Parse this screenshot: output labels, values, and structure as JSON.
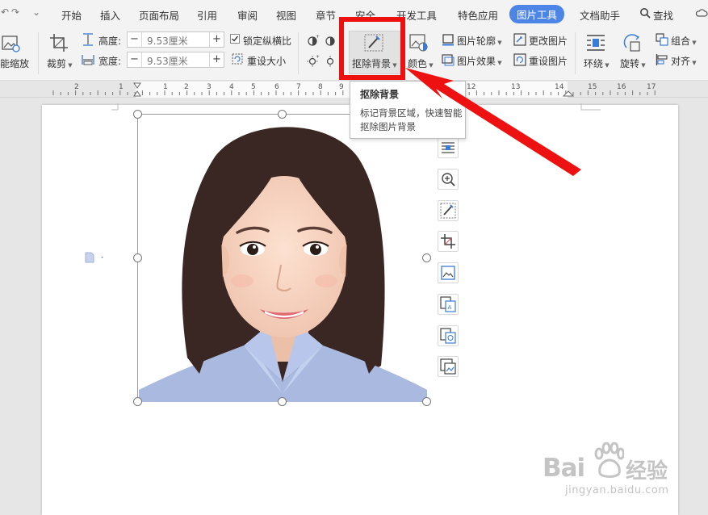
{
  "quick_access": {
    "undo": "↶",
    "redo": "↷",
    "more": "⌄"
  },
  "menu": {
    "items": [
      "开始",
      "插入",
      "页面布局",
      "引用",
      "审阅",
      "视图",
      "章节",
      "安全",
      "开发工具",
      "特色应用",
      "图片工具",
      "文档助手"
    ],
    "active": "图片工具",
    "search": "查找"
  },
  "ribbon": {
    "smart_zoom": "能缩放",
    "crop": "裁剪",
    "height_label": "高度:",
    "width_label": "宽度:",
    "height_value": "9.53厘米",
    "width_value": "9.53厘米",
    "lock_ratio": "锁定纵横比",
    "reset_size": "重设大小",
    "remove_bg": "抠除背景",
    "color": "颜色",
    "picture_outline": "图片轮廓",
    "picture_effects": "图片效果",
    "change_picture": "更改图片",
    "reset_picture": "重设图片",
    "wrap": "环绕",
    "rotate": "旋转",
    "group": "组合",
    "align": "对齐"
  },
  "ruler": {
    "numbers": [
      "2",
      "1",
      "1",
      "2",
      "3",
      "4",
      "5",
      "6",
      "7",
      "8",
      "9",
      "10",
      "11",
      "12",
      "13",
      "14",
      "15",
      "16",
      "17"
    ]
  },
  "tooltip": {
    "title": "抠除背景",
    "description": "标记背景区域，快速智能抠除图片背景"
  },
  "watermark": {
    "brand": "Bai",
    "brand2": "经验",
    "url": "jingyan.baidu.com"
  },
  "colors": {
    "accent": "#4d85e6",
    "highlight": "#ee1111",
    "arrow": "#ee1111",
    "shirt": "#a9b9e0"
  }
}
